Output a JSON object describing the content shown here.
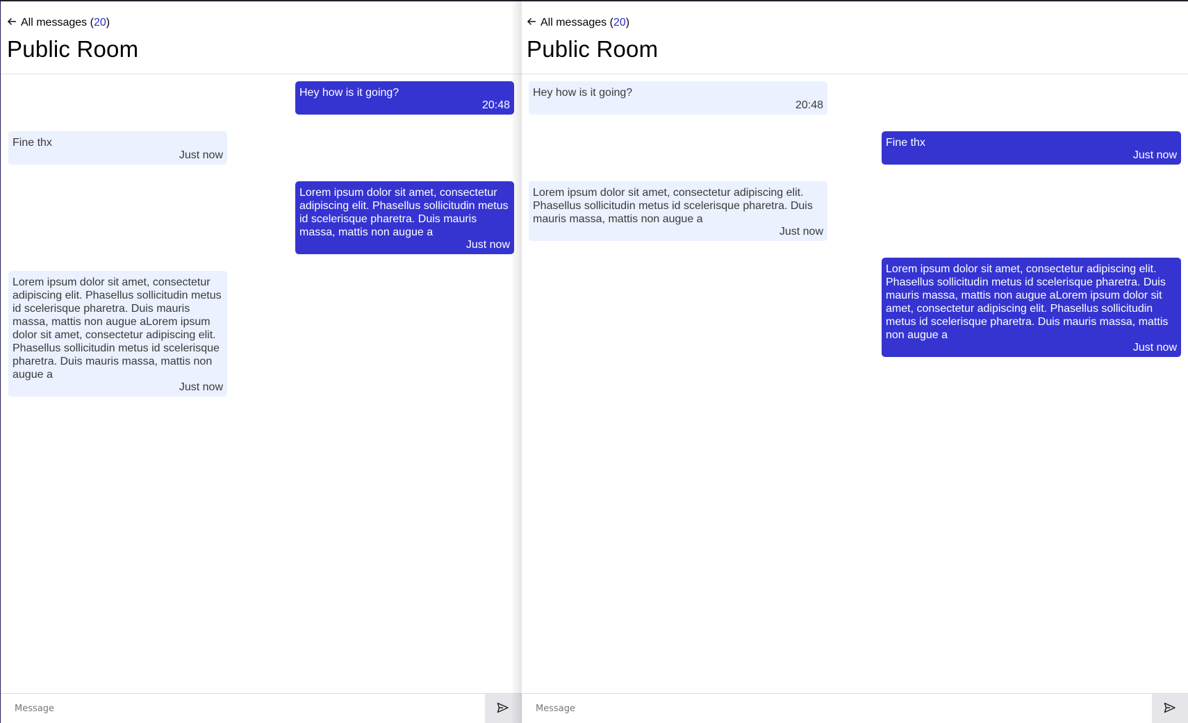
{
  "panes": [
    {
      "back_label": "All messages",
      "count": "20",
      "title": "Public Room",
      "messages": [
        {
          "text": "Hey how is it going?",
          "time": "20:48",
          "direction": "outgoing"
        },
        {
          "text": "Fine thx",
          "time": "Just now",
          "direction": "incoming"
        },
        {
          "text": "Lorem ipsum dolor sit amet, consectetur adipiscing elit. Phasellus sollicitudin metus id scelerisque pharetra. Duis mauris massa, mattis non augue a",
          "time": "Just now",
          "direction": "outgoing"
        },
        {
          "text": "Lorem ipsum dolor sit amet, consectetur adipiscing elit. Phasellus sollicitudin metus id scelerisque pharetra. Duis mauris massa, mattis non augue aLorem ipsum dolor sit amet, consectetur adipiscing elit. Phasellus sollicitudin metus id scelerisque pharetra. Duis mauris massa, mattis non augue a",
          "time": "Just now",
          "direction": "incoming"
        }
      ],
      "composer": {
        "placeholder": "Message",
        "value": ""
      }
    },
    {
      "back_label": "All messages",
      "count": "20",
      "title": "Public Room",
      "messages": [
        {
          "text": "Hey how is it going?",
          "time": "20:48",
          "direction": "incoming"
        },
        {
          "text": "Fine thx",
          "time": "Just now",
          "direction": "outgoing"
        },
        {
          "text": "Lorem ipsum dolor sit amet, consectetur adipiscing elit. Phasellus sollicitudin metus id scelerisque pharetra. Duis mauris massa, mattis non augue a",
          "time": "Just now",
          "direction": "incoming"
        },
        {
          "text": "Lorem ipsum dolor sit amet, consectetur adipiscing elit. Phasellus sollicitudin metus id scelerisque pharetra. Duis mauris massa, mattis non augue aLorem ipsum dolor sit amet, consectetur adipiscing elit. Phasellus sollicitudin metus id scelerisque pharetra. Duis mauris massa, mattis non augue a",
          "time": "Just now",
          "direction": "outgoing"
        }
      ],
      "composer": {
        "placeholder": "Message",
        "value": ""
      }
    }
  ],
  "icons": {
    "back": "arrow-left-icon",
    "send": "send-icon"
  },
  "colors": {
    "accent": "#3534d1",
    "incoming_bubble": "#ebf1fe",
    "count_link": "#2c2dcf"
  }
}
